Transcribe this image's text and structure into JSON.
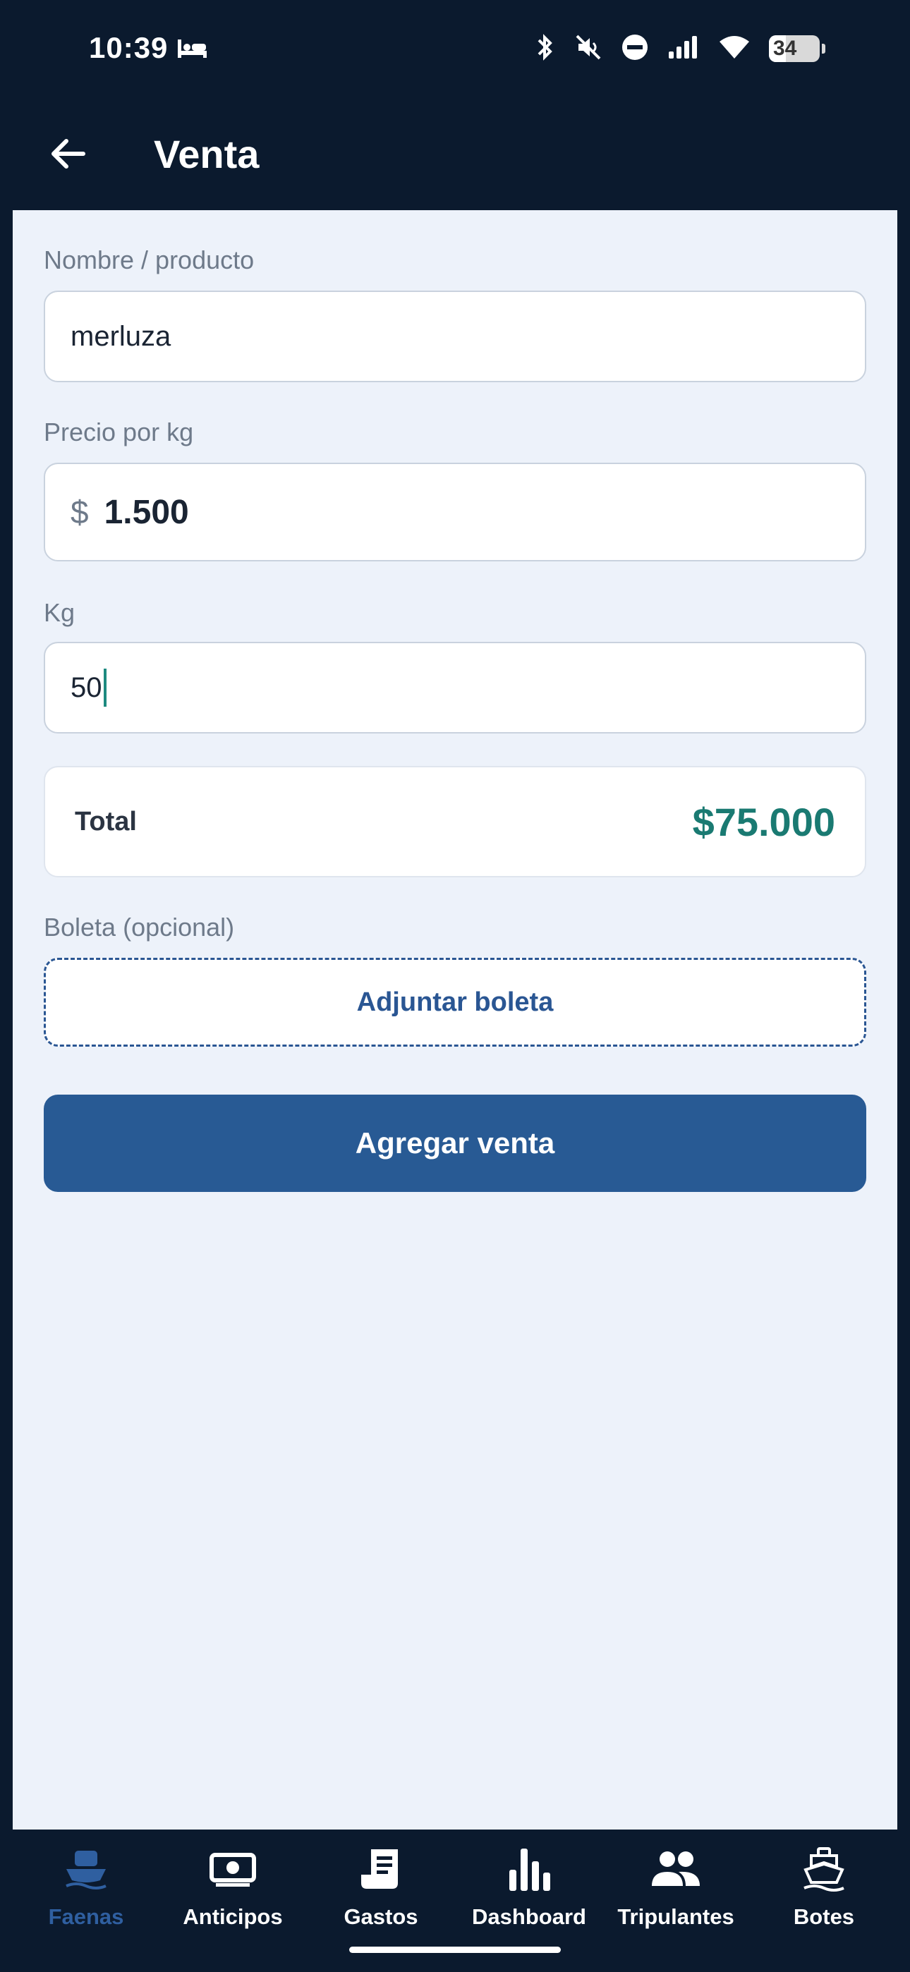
{
  "status_bar": {
    "time": "10:39",
    "battery": "34"
  },
  "app_bar": {
    "title": "Venta"
  },
  "form": {
    "name_label": "Nombre / producto",
    "name_value": "merluza",
    "price_label": "Precio por kg",
    "price_currency": "$",
    "price_value": "1.500",
    "kg_label": "Kg",
    "kg_value": "50",
    "total_label": "Total",
    "total_value": "$75.000",
    "receipt_label": "Boleta (opcional)",
    "attach_label": "Adjuntar boleta",
    "submit_label": "Agregar venta"
  },
  "bottom_nav": {
    "items": [
      {
        "label": "Faenas",
        "icon": "boat-icon",
        "active": true
      },
      {
        "label": "Anticipos",
        "icon": "money-icon",
        "active": false
      },
      {
        "label": "Gastos",
        "icon": "receipt-icon",
        "active": false
      },
      {
        "label": "Dashboard",
        "icon": "bar-chart-icon",
        "active": false
      },
      {
        "label": "Tripulantes",
        "icon": "people-icon",
        "active": false
      },
      {
        "label": "Botes",
        "icon": "ship-icon",
        "active": false
      }
    ]
  },
  "colors": {
    "header_bg": "#0b1a2e",
    "content_bg": "#edf2fa",
    "primary": "#285a94",
    "total_accent": "#1a7a72",
    "nav_active": "#2f5fa0"
  }
}
